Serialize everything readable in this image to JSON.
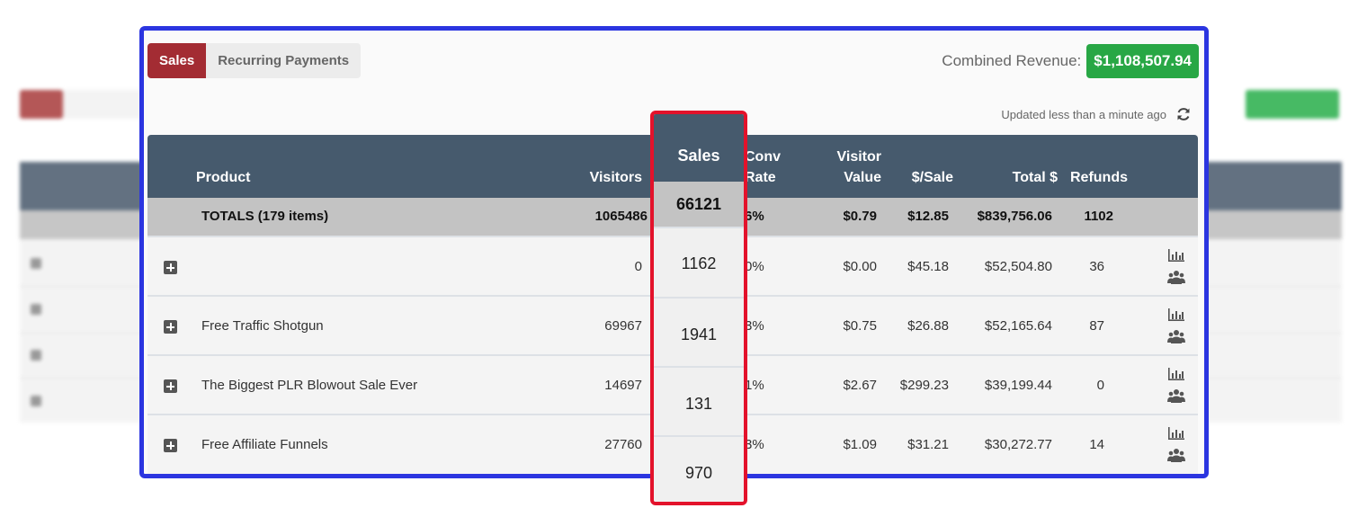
{
  "tabs": {
    "sales": "Sales",
    "recurring": "Recurring Payments"
  },
  "revenue": {
    "label": "Combined Revenue:",
    "value": "$1,108,507.94"
  },
  "updated": "Updated less than a minute ago",
  "headers": {
    "product": "Product",
    "visitors": "Visitors",
    "sales": "Sales",
    "conv_line1": "Conv",
    "conv_line2": "Rate",
    "visitor_line1": "Visitor",
    "visitor_line2": "Value",
    "per_sale": "$/Sale",
    "total": "Total $",
    "refunds": "Refunds"
  },
  "totals": {
    "label": "TOTALS (179 items)",
    "visitors": "1065486",
    "sales": "66121",
    "conv": "6%",
    "visitor_value": "$0.79",
    "per_sale": "$12.85",
    "total": "$839,756.06",
    "refunds": "1102"
  },
  "rows": [
    {
      "product": "",
      "visitors": "0",
      "sales": "1162",
      "conv": "0%",
      "visitor_value": "$0.00",
      "per_sale": "$45.18",
      "total": "$52,504.80",
      "refunds": "36"
    },
    {
      "product": "Free Traffic Shotgun",
      "visitors": "69967",
      "sales": "1941",
      "conv": "3%",
      "visitor_value": "$0.75",
      "per_sale": "$26.88",
      "total": "$52,165.64",
      "refunds": "87"
    },
    {
      "product": "The Biggest PLR Blowout Sale Ever",
      "visitors": "14697",
      "sales": "131",
      "conv": "1%",
      "visitor_value": "$2.67",
      "per_sale": "$299.23",
      "total": "$39,199.44",
      "refunds": "0"
    },
    {
      "product": "Free Affiliate Funnels",
      "visitors": "27760",
      "sales": "970",
      "conv": "3%",
      "visitor_value": "$1.09",
      "per_sale": "$31.21",
      "total": "$30,272.77",
      "refunds": "14"
    }
  ],
  "colors": {
    "sales_tab": "#a32c33",
    "revenue_badge": "#28a745",
    "header": "#465a6d",
    "panel_border": "#2b35e0",
    "highlight_border": "#e3122b"
  }
}
